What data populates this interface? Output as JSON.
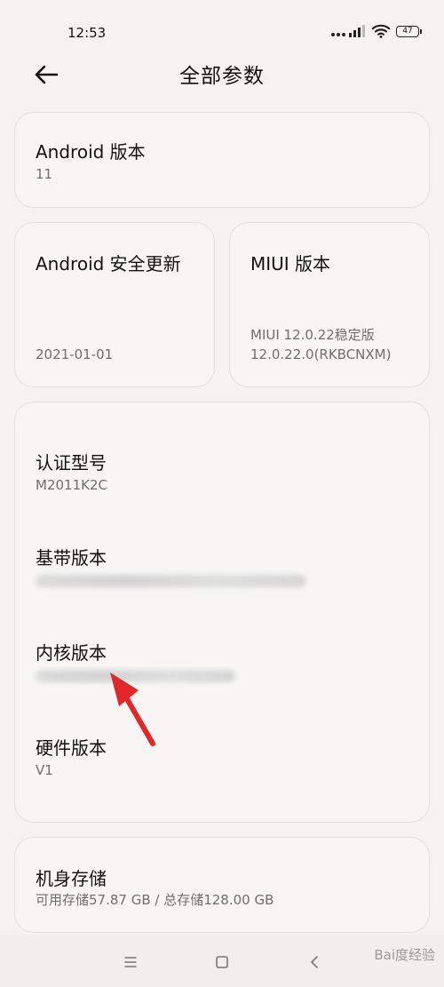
{
  "status_bar": {
    "time": "12:53",
    "battery": "47"
  },
  "header": {
    "title": "全部参数"
  },
  "android_version": {
    "title": "Android 版本",
    "value": "11"
  },
  "security_update": {
    "title": "Android 安全更新",
    "value": "2021-01-01"
  },
  "miui_version": {
    "title": "MIUI 版本",
    "value_line1": "MIUI 12.0.22稳定版",
    "value_line2": "12.0.22.0(RKBCNXM)"
  },
  "details": {
    "model_title": "认证型号",
    "model_value": "M2011K2C",
    "baseband_title": "基带版本",
    "kernel_title": "内核版本",
    "hardware_title": "硬件版本",
    "hardware_value": "V1"
  },
  "storage": {
    "title": "机身存储",
    "value": "可用存储57.87 GB / 总存储128.00 GB"
  },
  "watermark": {
    "text": "Bai度经验"
  },
  "icons": {
    "back": "arrow-left-icon",
    "menu": "menu-icon",
    "home": "home-icon",
    "nav_back": "chevron-left-icon"
  },
  "colors": {
    "background": "#f4f3f2",
    "card": "#f7f6f5",
    "annotation_arrow": "#e0272a"
  }
}
